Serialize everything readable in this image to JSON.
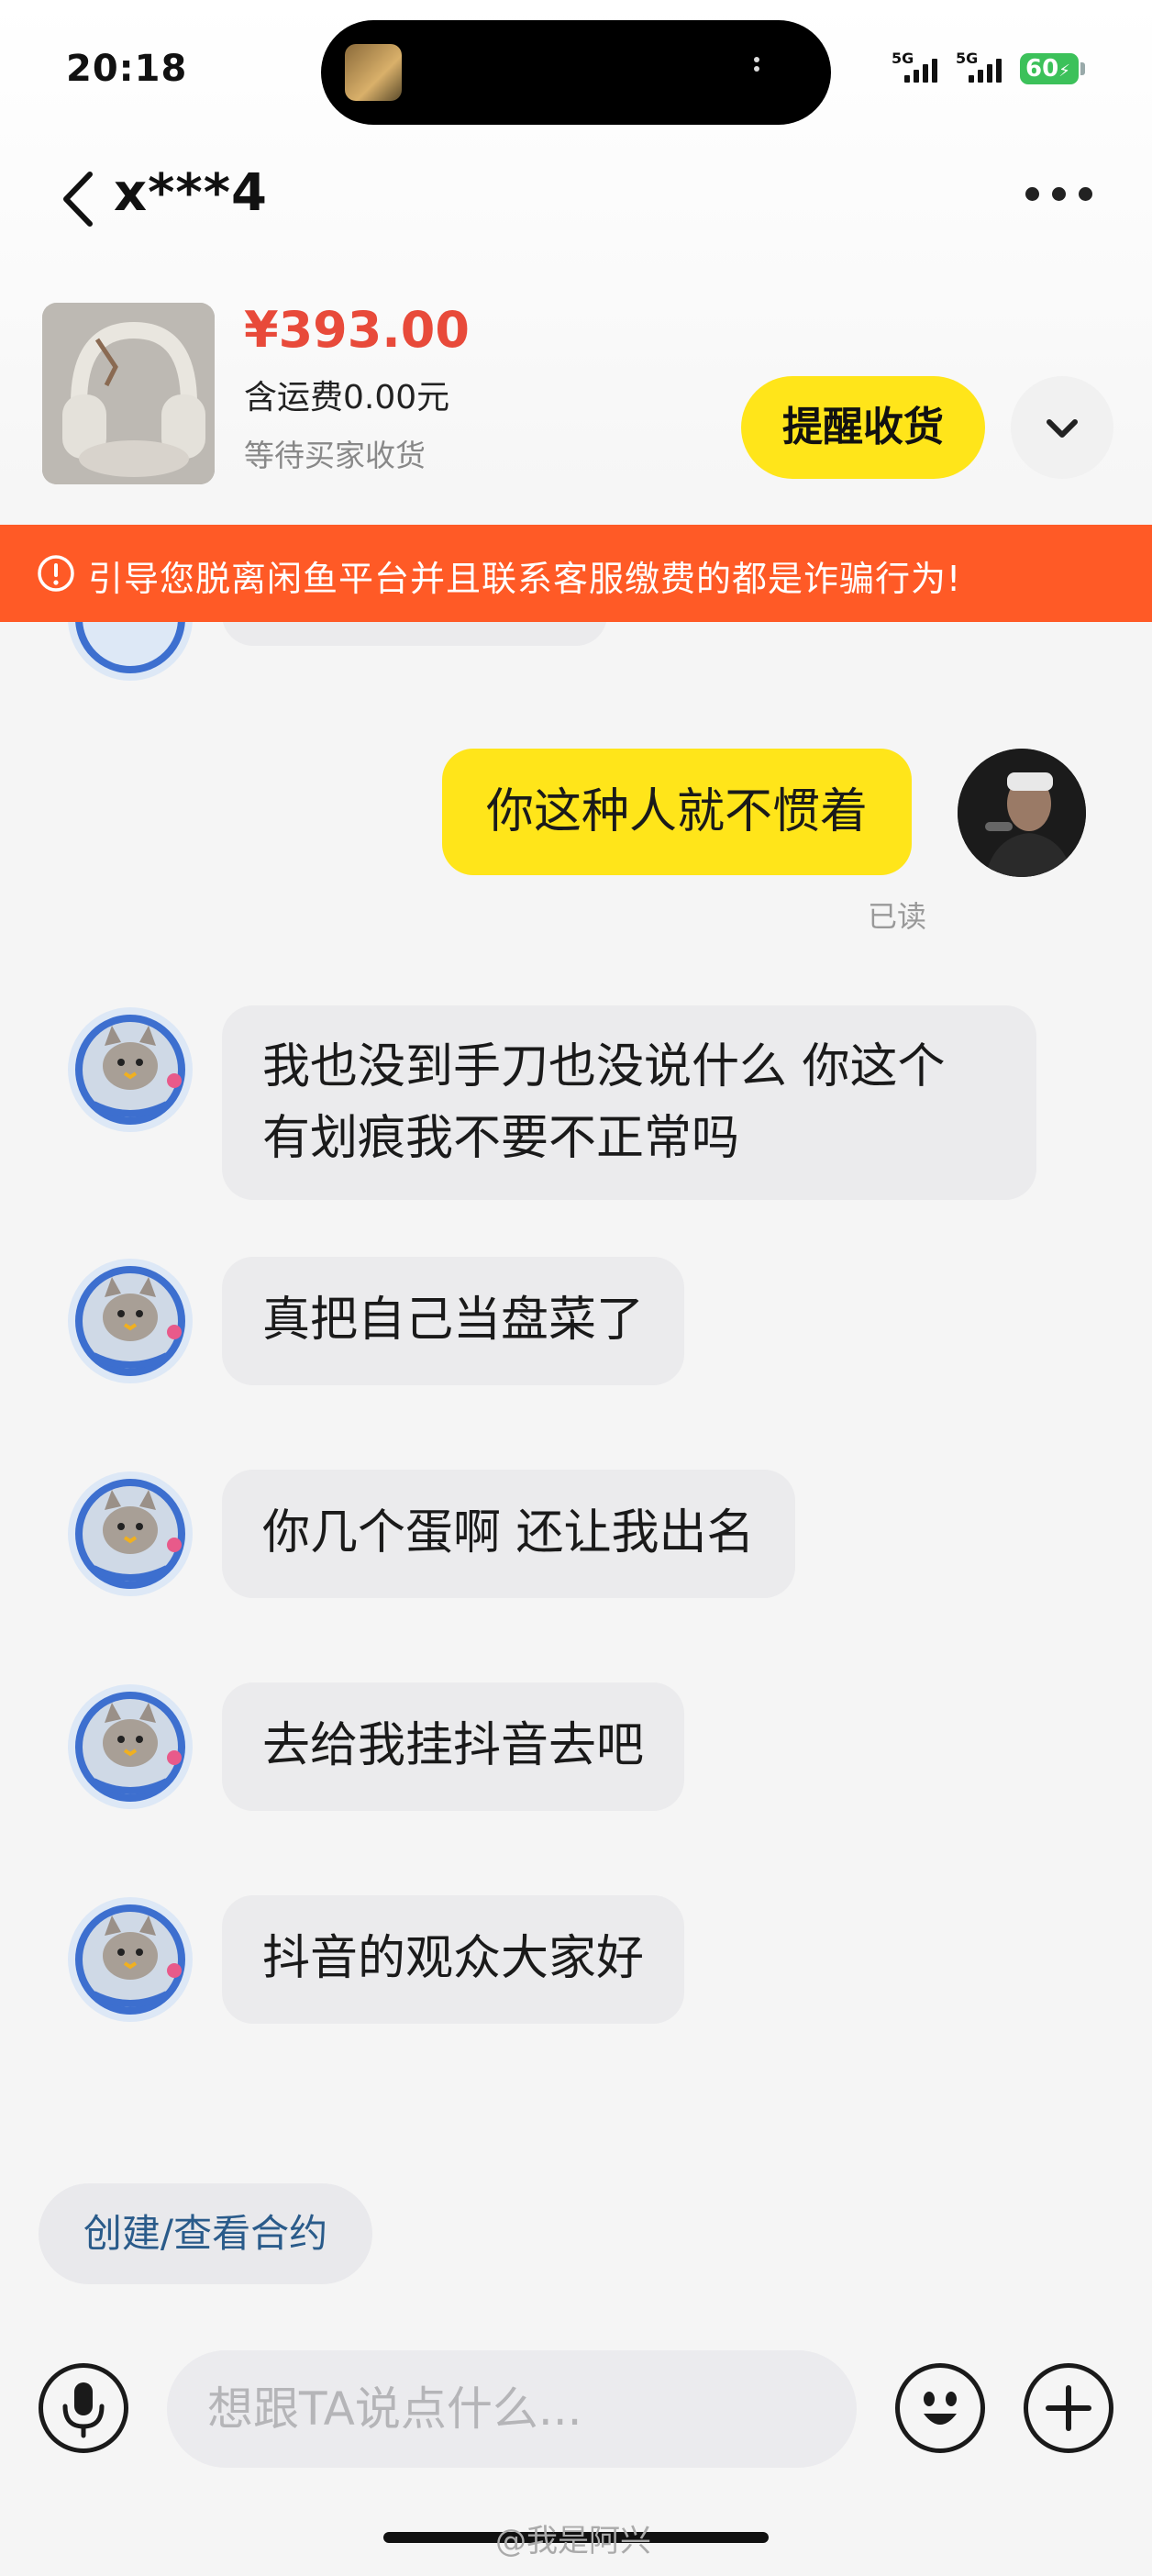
{
  "status_bar": {
    "time": "20:18",
    "network_1": "5G",
    "network_2": "5G",
    "battery": "60"
  },
  "header": {
    "title": "x***4",
    "back_icon": "chevron-left-icon",
    "more_icon": "more-dots-icon"
  },
  "product": {
    "price": "¥393.00",
    "shipping": "含运费0.00元",
    "status": "等待买家收货",
    "remind_button": "提醒收货"
  },
  "warning": {
    "text": "引导您脱离闲鱼平台并且联系客服缴费的都是诈骗行为!"
  },
  "messages": [
    {
      "direction": "out",
      "text": "你这种人就不惯着",
      "read_status": "已读"
    },
    {
      "direction": "in",
      "line1": "我也没到手刀也没说什么 你这个",
      "line2": "有划痕我不要不正常吗"
    },
    {
      "direction": "in",
      "text": "真把自己当盘菜了"
    },
    {
      "direction": "in",
      "text": "你几个蛋啊 还让我出名"
    },
    {
      "direction": "in",
      "text": "去给我挂抖音去吧"
    },
    {
      "direction": "in",
      "text": "抖音的观众大家好"
    }
  ],
  "contract_chip": "创建/查看合约",
  "input": {
    "placeholder": "想跟TA说点什么...",
    "voice_icon": "microphone-icon",
    "emoji_icon": "emoji-icon",
    "add_icon": "plus-icon"
  },
  "watermark": "@我是阿兴",
  "colors": {
    "accent_yellow": "#ffe51a",
    "price_red": "#e84a3a",
    "warning_orange": "#ff5a26",
    "battery_green": "#3cc15a"
  }
}
